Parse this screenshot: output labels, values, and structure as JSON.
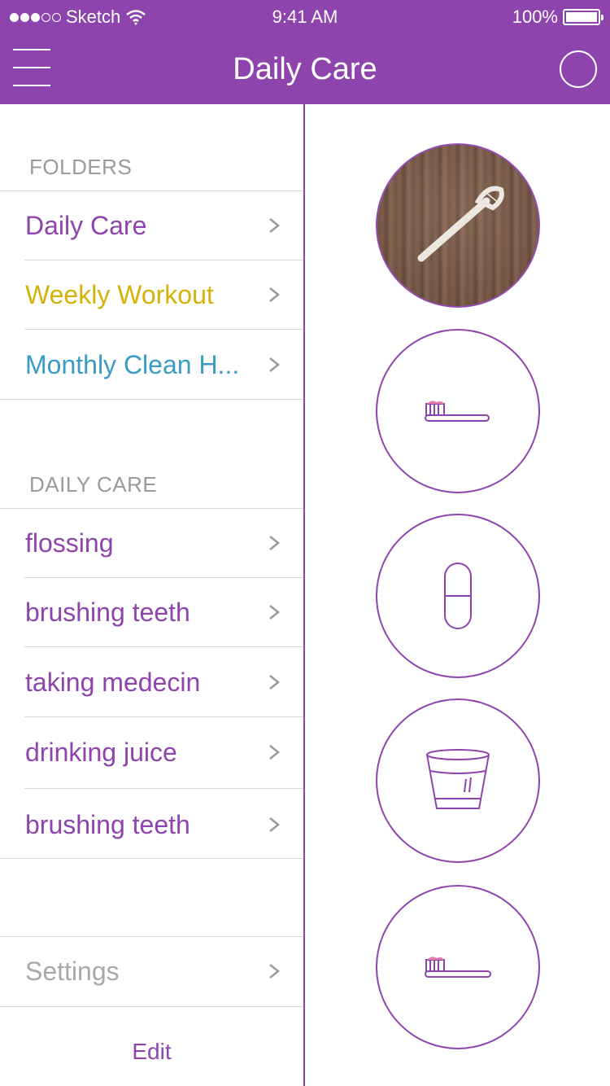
{
  "status_bar": {
    "carrier": "Sketch",
    "time": "9:41 AM",
    "battery": "100%"
  },
  "header": {
    "title": "Daily Care",
    "menu_icon": "hamburger-menu-icon",
    "right_icon": "sync-circle-icon"
  },
  "sidebar": {
    "folders_label": "FOLDERS",
    "folders": [
      {
        "label": "Daily Care",
        "color": "#8e44ad"
      },
      {
        "label": "Weekly Workout",
        "color": "#d4b20a"
      },
      {
        "label": "Monthly Clean H...",
        "color": "#3a9bc6"
      }
    ],
    "section_label": "DAILY CARE",
    "items": [
      {
        "label": "flossing"
      },
      {
        "label": "brushing teeth"
      },
      {
        "label": "taking medecin"
      },
      {
        "label": "drinking juice"
      },
      {
        "label": "brushing teeth"
      }
    ],
    "settings_label": "Settings",
    "edit_label": "Edit"
  },
  "tasks": [
    {
      "icon": "floss-pick-photo"
    },
    {
      "icon": "toothbrush-icon"
    },
    {
      "icon": "pill-capsule-icon"
    },
    {
      "icon": "glass-cup-icon"
    },
    {
      "icon": "toothbrush-icon"
    }
  ],
  "colors": {
    "accent": "#8e44ad",
    "separator": "#d8d8d8",
    "muted": "#9a9a9a"
  }
}
